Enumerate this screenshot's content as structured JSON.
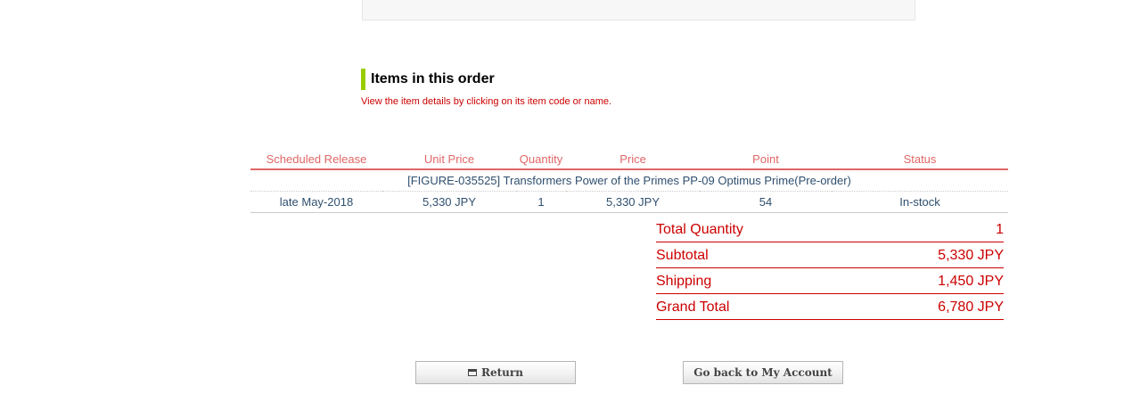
{
  "section": {
    "title": "Items in this order",
    "note": "View the item details by clicking on its item code or name."
  },
  "table": {
    "headers": {
      "release": "Scheduled Release",
      "unit_price": "Unit Price",
      "quantity": "Quantity",
      "price": "Price",
      "point": "Point",
      "status": "Status"
    },
    "item": {
      "name": "[FIGURE-035525] Transformers Power of the Primes PP-09 Optimus Prime(Pre-order)",
      "release": "late May-2018",
      "unit_price": "5,330 JPY",
      "quantity": "1",
      "price": "5,330 JPY",
      "point": "54",
      "status": "In-stock"
    }
  },
  "totals": [
    {
      "label": "Total Quantity",
      "value": "1"
    },
    {
      "label": "Subtotal",
      "value": "5,330 JPY"
    },
    {
      "label": "Shipping",
      "value": "1,450 JPY"
    },
    {
      "label": "Grand Total",
      "value": "6,780 JPY"
    }
  ],
  "buttons": {
    "return_label": "Return",
    "account_label": "Go back to My Account"
  },
  "icons": {
    "return": "window-icon"
  },
  "colors": {
    "accent_bar": "#99cc00",
    "header_text": "#e06666",
    "totals_text": "#cc0000",
    "body_text": "#2f4f6f"
  }
}
